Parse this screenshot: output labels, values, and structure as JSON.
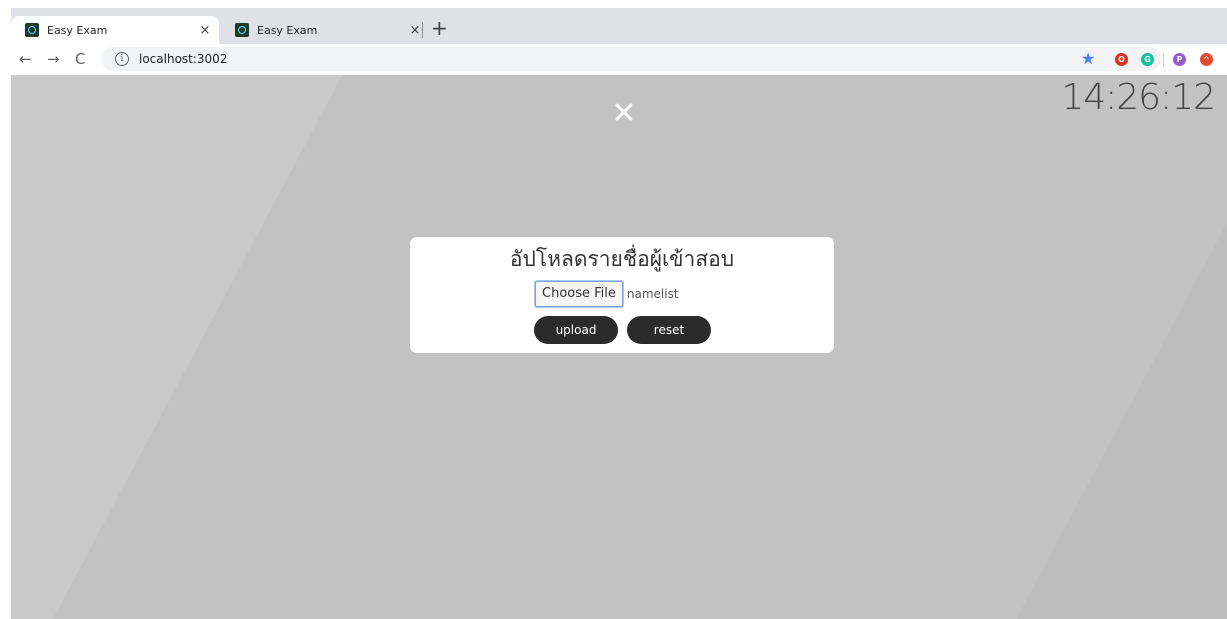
{
  "browser": {
    "tabs": [
      {
        "title": "Easy Exam",
        "active": true
      },
      {
        "title": "Easy Exam",
        "active": false
      }
    ],
    "close_glyph": "×",
    "new_tab_glyph": "+",
    "nav": {
      "back": "←",
      "forward": "→",
      "reload": "C"
    },
    "url": "localhost:3002",
    "info_glyph": "i",
    "extensions": [
      {
        "name": "star-bookmark-icon",
        "glyph": "★",
        "color": "#4a7ef2"
      },
      {
        "name": "opera-extension-icon",
        "glyph": "O",
        "color": "#d93025"
      },
      {
        "name": "grammarly-extension-icon",
        "glyph": "G",
        "color": "#15c39a"
      },
      {
        "name": "profile-extension-icon",
        "glyph": "P",
        "color": "#9b59d0"
      },
      {
        "name": "red-extension-icon",
        "glyph": "^",
        "color": "#e24a2e"
      }
    ]
  },
  "page": {
    "close_glyph": "✕",
    "clock": "14:26:12",
    "card": {
      "title": "อัปโหลดรายชื่อผู้เข้าสอบ",
      "file_button": "Choose File",
      "file_name": "namelist",
      "upload_label": "upload",
      "reset_label": "reset"
    }
  }
}
